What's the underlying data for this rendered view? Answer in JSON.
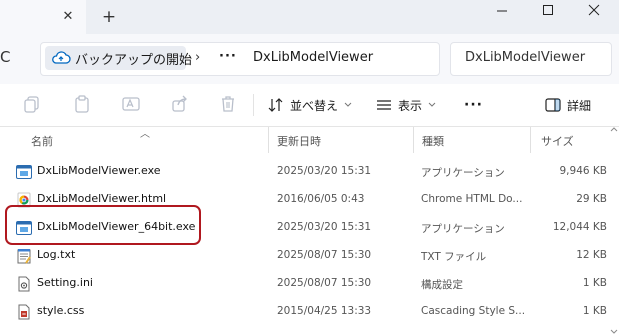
{
  "titlebar": {
    "tab_close_glyph": "✕",
    "new_tab_glyph": "+",
    "window_buttons": {
      "minimize": "—",
      "maximize": "☐",
      "close": "✕"
    }
  },
  "address": {
    "refresh_glyph": "C",
    "home_label": "バックアップの開始",
    "separator": "›",
    "overflow": "···",
    "current_folder": "DxLibModelViewer",
    "search_placeholder": "DxLibModelViewer"
  },
  "toolbar": {
    "sort_label": "並べ替え",
    "view_label": "表示",
    "more_label": "···",
    "details_label": "詳細"
  },
  "columns": {
    "name": "名前",
    "date": "更新日時",
    "type": "種類",
    "size": "サイズ"
  },
  "files": [
    {
      "name": "DxLibModelViewer.exe",
      "date": "2025/03/20 15:31",
      "type": "アプリケーション",
      "size": "9,946 KB",
      "icon": "exe-icon"
    },
    {
      "name": "DxLibModelViewer.html",
      "date": "2016/06/05 0:43",
      "type": "Chrome HTML Do...",
      "size": "29 KB",
      "icon": "chrome-html-icon"
    },
    {
      "name": "DxLibModelViewer_64bit.exe",
      "date": "2025/03/20 15:31",
      "type": "アプリケーション",
      "size": "12,044 KB",
      "icon": "exe-icon"
    },
    {
      "name": "Log.txt",
      "date": "2025/08/07 15:30",
      "type": "TXT ファイル",
      "size": "12 KB",
      "icon": "text-file-icon"
    },
    {
      "name": "Setting.ini",
      "date": "2025/08/07 15:30",
      "type": "構成設定",
      "size": "1 KB",
      "icon": "settings-file-icon"
    },
    {
      "name": "style.css",
      "date": "2015/04/25 13:33",
      "type": "Cascading Style S...",
      "size": "1 KB",
      "icon": "css-file-icon"
    }
  ],
  "colors": {
    "accent": "#0067c0",
    "highlight_border": "#b0181f",
    "chrome_bg": "#eceff4"
  }
}
